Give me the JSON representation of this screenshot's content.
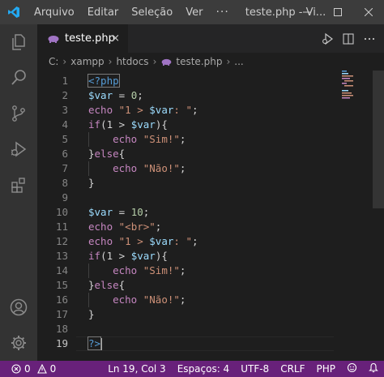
{
  "titlebar": {
    "menu": [
      "Arquivo",
      "Editar",
      "Seleção",
      "Ver"
    ],
    "more": "···",
    "window_title": "teste.php - Vi..."
  },
  "tab": {
    "label": "teste.php",
    "close": "×",
    "icon": "php-elephant-icon"
  },
  "breadcrumb": {
    "items": [
      "C:",
      "xampp",
      "htdocs",
      "teste.php",
      "..."
    ],
    "separator": "›"
  },
  "editor": {
    "line_numbers": [
      "1",
      "2",
      "3",
      "4",
      "5",
      "6",
      "7",
      "8",
      "9",
      "10",
      "11",
      "12",
      "13",
      "14",
      "15",
      "16",
      "17",
      "18",
      "19"
    ],
    "active_line": 19,
    "lines": [
      [
        {
          "c": "tag",
          "t": "<?php"
        }
      ],
      [
        {
          "c": "var",
          "t": "$var"
        },
        {
          "c": "op",
          "t": " = "
        },
        {
          "c": "num",
          "t": "0"
        },
        {
          "c": "op",
          "t": ";"
        }
      ],
      [
        {
          "c": "kw",
          "t": "echo"
        },
        {
          "c": "op",
          "t": " "
        },
        {
          "c": "str",
          "t": "\"1 > "
        },
        {
          "c": "var",
          "t": "$var"
        },
        {
          "c": "str",
          "t": ": \""
        },
        {
          "c": "op",
          "t": ";"
        }
      ],
      [
        {
          "c": "kw",
          "t": "if"
        },
        {
          "c": "op",
          "t": "(1 > "
        },
        {
          "c": "var",
          "t": "$var"
        },
        {
          "c": "op",
          "t": "){"
        }
      ],
      [
        {
          "c": "op",
          "t": "    "
        },
        {
          "c": "kw",
          "t": "echo"
        },
        {
          "c": "op",
          "t": " "
        },
        {
          "c": "str",
          "t": "\"Sim!\""
        },
        {
          "c": "op",
          "t": ";"
        }
      ],
      [
        {
          "c": "op",
          "t": "}"
        },
        {
          "c": "kw",
          "t": "else"
        },
        {
          "c": "op",
          "t": "{"
        }
      ],
      [
        {
          "c": "op",
          "t": "    "
        },
        {
          "c": "kw",
          "t": "echo"
        },
        {
          "c": "op",
          "t": " "
        },
        {
          "c": "str",
          "t": "\"Não!\""
        },
        {
          "c": "op",
          "t": ";"
        }
      ],
      [
        {
          "c": "op",
          "t": "}"
        }
      ],
      [],
      [
        {
          "c": "var",
          "t": "$var"
        },
        {
          "c": "op",
          "t": " = "
        },
        {
          "c": "num",
          "t": "10"
        },
        {
          "c": "op",
          "t": ";"
        }
      ],
      [
        {
          "c": "kw",
          "t": "echo"
        },
        {
          "c": "op",
          "t": " "
        },
        {
          "c": "str",
          "t": "\"<br>\""
        },
        {
          "c": "op",
          "t": ";"
        }
      ],
      [
        {
          "c": "kw",
          "t": "echo"
        },
        {
          "c": "op",
          "t": " "
        },
        {
          "c": "str",
          "t": "\"1 > "
        },
        {
          "c": "var",
          "t": "$var"
        },
        {
          "c": "str",
          "t": ": \""
        },
        {
          "c": "op",
          "t": ";"
        }
      ],
      [
        {
          "c": "kw",
          "t": "if"
        },
        {
          "c": "op",
          "t": "(1 > "
        },
        {
          "c": "var",
          "t": "$var"
        },
        {
          "c": "op",
          "t": "){"
        }
      ],
      [
        {
          "c": "op",
          "t": "    "
        },
        {
          "c": "kw",
          "t": "echo"
        },
        {
          "c": "op",
          "t": " "
        },
        {
          "c": "str",
          "t": "\"Sim!\""
        },
        {
          "c": "op",
          "t": ";"
        }
      ],
      [
        {
          "c": "op",
          "t": "}"
        },
        {
          "c": "kw",
          "t": "else"
        },
        {
          "c": "op",
          "t": "{"
        }
      ],
      [
        {
          "c": "op",
          "t": "    "
        },
        {
          "c": "kw",
          "t": "echo"
        },
        {
          "c": "op",
          "t": " "
        },
        {
          "c": "str",
          "t": "\"Não!\""
        },
        {
          "c": "op",
          "t": ";"
        }
      ],
      [
        {
          "c": "op",
          "t": "}"
        }
      ],
      [],
      [
        {
          "c": "tag",
          "t": "?>"
        }
      ]
    ]
  },
  "statusbar": {
    "errors": "0",
    "warnings": "0",
    "position": "Ln 19, Col 3",
    "indent": "Espaços: 4",
    "encoding": "UTF-8",
    "eol": "CRLF",
    "language": "PHP"
  },
  "colors": {
    "status_bar": "#68217a",
    "activity_bar": "#333333",
    "title_bar": "#3c3c3c",
    "editor_bg": "#1e1e1e",
    "vscode_blue": "#23a9f2"
  }
}
